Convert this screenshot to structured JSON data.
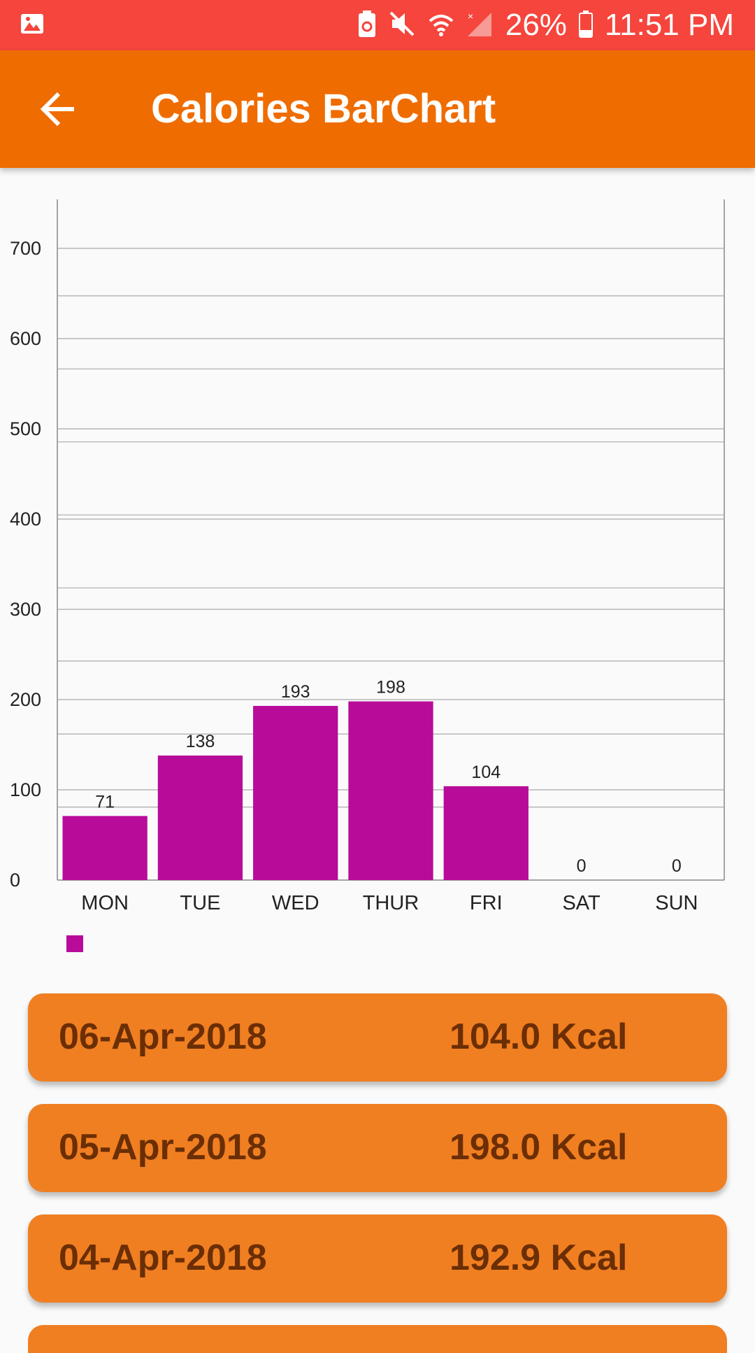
{
  "status_bar": {
    "battery": "26%",
    "time": "11:51 PM",
    "icons": [
      "gallery-icon",
      "battery-saver-icon",
      "mute-icon",
      "wifi-icon",
      "signal-icon",
      "battery-icon"
    ]
  },
  "app_bar": {
    "title": "Calories BarChart",
    "back_icon": "back-arrow-icon"
  },
  "chart_data": {
    "type": "bar",
    "categories": [
      "MON",
      "TUE",
      "WED",
      "THUR",
      "FRI",
      "SAT",
      "SUN"
    ],
    "values": [
      71,
      138,
      193,
      198,
      104,
      0,
      0
    ],
    "value_labels": [
      "71",
      "138",
      "193",
      "198",
      "104",
      "0",
      "0"
    ],
    "y_ticks": [
      0,
      100,
      200,
      300,
      400,
      500,
      600,
      700
    ],
    "ylim": [
      0,
      700
    ],
    "bar_color": "#b80b9a",
    "legend": {
      "placement": "bottom-left",
      "entries": [
        ""
      ]
    },
    "grid": true
  },
  "records": [
    {
      "date": "06-Apr-2018",
      "kcal": "104.0 Kcal"
    },
    {
      "date": "05-Apr-2018",
      "kcal": "198.0 Kcal"
    },
    {
      "date": "04-Apr-2018",
      "kcal": "192.9 Kcal"
    }
  ],
  "colors": {
    "status_bar": "#f5453d",
    "app_bar": "#ef6c00",
    "card": "#f07f22",
    "card_text": "#6b2e05",
    "bar": "#b80b9a"
  }
}
